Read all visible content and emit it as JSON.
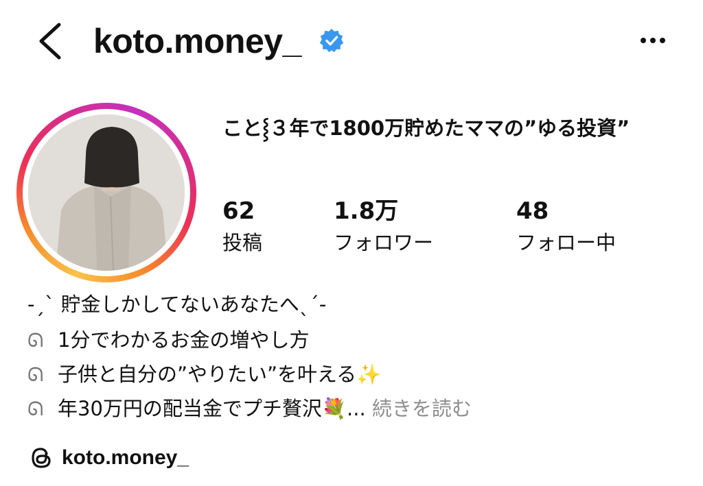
{
  "header": {
    "username": "koto.money_",
    "verified": true,
    "back_icon": "chevron-left-icon",
    "more_icon": "more-horizontal-icon",
    "accent_color": "#3897f0"
  },
  "profile": {
    "display_name": "こと⸾３年で1800万貯めたママの”ゆる投資”",
    "avatar_ring_colors": [
      "#f9c24a",
      "#f88a2c",
      "#ee2f55",
      "#d62e8f",
      "#c531bd"
    ]
  },
  "stats": [
    {
      "count": "62",
      "label": "投稿"
    },
    {
      "count": "1.8万",
      "label": "フォロワー"
    },
    {
      "count": "48",
      "label": "フォロー中"
    }
  ],
  "bio": {
    "line1": "-ˏˋ 貯金しかしてないあなたへˎˊ-",
    "lines": [
      {
        "icon": "ribbon-icon",
        "text": "1分でわかるお金の増やし方"
      },
      {
        "icon": "ribbon-icon",
        "text": "子供と自分の”やりたい”を叶える✨"
      },
      {
        "icon": "ribbon-icon",
        "text": "年30万円の配当金でプチ贅沢💐..."
      }
    ],
    "more_label": "続きを読む"
  },
  "threads": {
    "handle": "koto.money_",
    "icon": "threads-icon"
  }
}
